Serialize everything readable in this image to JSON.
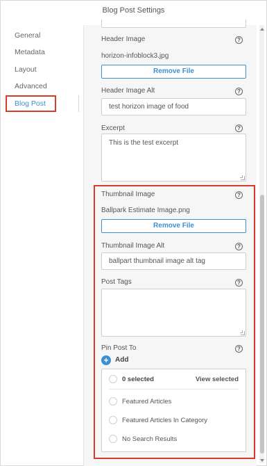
{
  "window": {
    "title": "Blog Post Settings"
  },
  "sidebar": {
    "items": [
      {
        "label": "General"
      },
      {
        "label": "Metadata"
      },
      {
        "label": "Layout"
      },
      {
        "label": "Advanced"
      },
      {
        "label": "Blog Post",
        "active": true
      }
    ]
  },
  "header_image": {
    "label": "Header Image",
    "filename": "horizon-infoblock3.jpg",
    "remove_label": "Remove File"
  },
  "header_image_alt": {
    "label": "Header Image Alt",
    "value": "test horizon image of food"
  },
  "excerpt": {
    "label": "Excerpt",
    "value": "This is the test excerpt"
  },
  "thumbnail_image": {
    "label": "Thumbnail Image",
    "filename": "Ballpark Estimate Image.png",
    "remove_label": "Remove File"
  },
  "thumbnail_image_alt": {
    "label": "Thumbnail Image Alt",
    "value": "ballpart thumbnail image alt tag"
  },
  "post_tags": {
    "label": "Post Tags",
    "value": ""
  },
  "pin_post_to": {
    "label": "Pin Post To",
    "add_label": "Add",
    "selected_count": "0 selected",
    "view_selected": "View selected",
    "options": [
      {
        "label": "Featured Articles"
      },
      {
        "label": "Featured Articles In Category"
      },
      {
        "label": "No Search Results"
      }
    ]
  },
  "help_icon": "?",
  "plus_icon": "+",
  "colors": {
    "accent": "#3d8fd1",
    "highlight": "#d83a2b",
    "panel_bg": "#f6f6f6"
  }
}
